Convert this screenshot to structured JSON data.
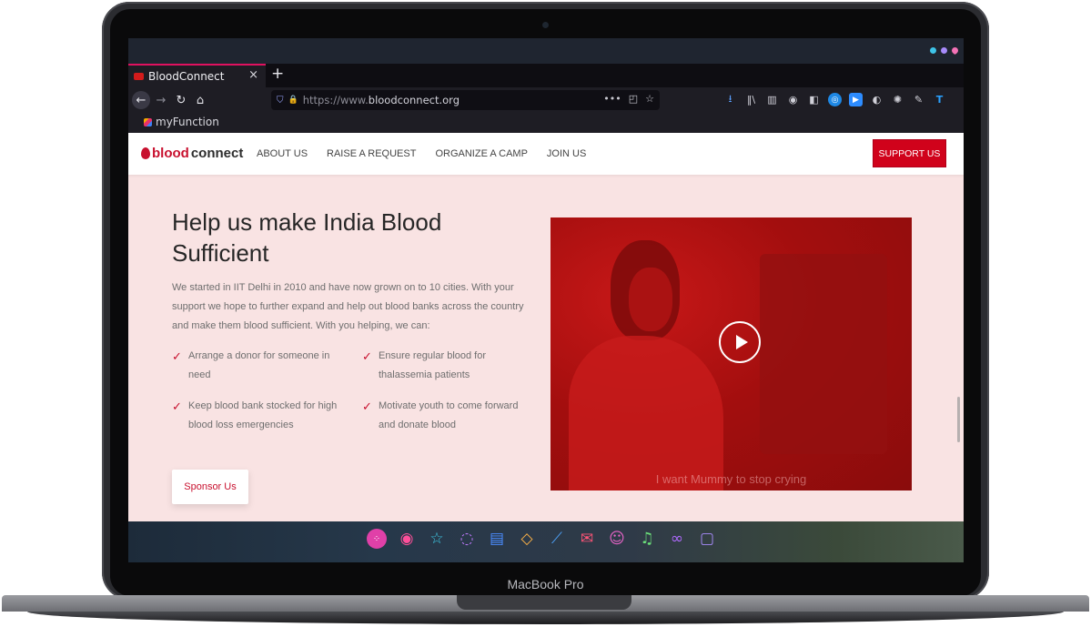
{
  "device": {
    "label": "MacBook Pro"
  },
  "os": {
    "indicator_colors": [
      "#3ec4e8",
      "#a78bfa",
      "#f472b6"
    ]
  },
  "browser": {
    "tab": {
      "title": "BloodConnect",
      "close": "×"
    },
    "new_tab": "+",
    "nav": {
      "back": "←",
      "forward": "→",
      "reload": "↻",
      "home": "⌂"
    },
    "url": {
      "scheme": "https://www.",
      "host": "bloodconnect.org"
    },
    "url_actions": [
      "•••",
      "◰",
      "☆"
    ],
    "toolbar_icons": [
      "download-icon",
      "library-icon",
      "sidebar-icon",
      "account-icon",
      "container-icon",
      "extension-blue-icon",
      "zoom-icon",
      "dark-reader-icon",
      "addon-icon",
      "pencil-icon",
      "t-icon",
      "menu-icon"
    ],
    "bookmark": {
      "label": "myFunction"
    }
  },
  "site": {
    "logo": {
      "part1": "blood",
      "part2": "connect"
    },
    "nav_links": [
      "ABOUT US",
      "RAISE A REQUEST",
      "ORGANIZE A CAMP",
      "JOIN US"
    ],
    "support_button": "SUPPORT US",
    "headline": "Help us make India Blood Sufficient",
    "intro": "We started in IIT Delhi in 2010 and have now grown on to 10 cities. With your support we hope to further expand and help out blood banks across the country and make them blood sufficient. With you helping, we can:",
    "features": [
      "Arrange a donor for someone in need",
      "Ensure regular blood for thalassemia patients",
      "Keep blood bank stocked for high blood loss emergencies",
      "Motivate youth to come forward and donate blood"
    ],
    "sponsor_button": "Sponsor Us",
    "video": {
      "caption": "I want Mummy to stop crying"
    }
  },
  "dock": {
    "icons": [
      "launcher-icon",
      "firefox-icon",
      "star-icon",
      "chat-icon",
      "notes-icon",
      "tag-icon",
      "brush-icon",
      "mail-icon",
      "ghost-icon",
      "music-icon",
      "infinity-icon",
      "window-icon"
    ]
  }
}
